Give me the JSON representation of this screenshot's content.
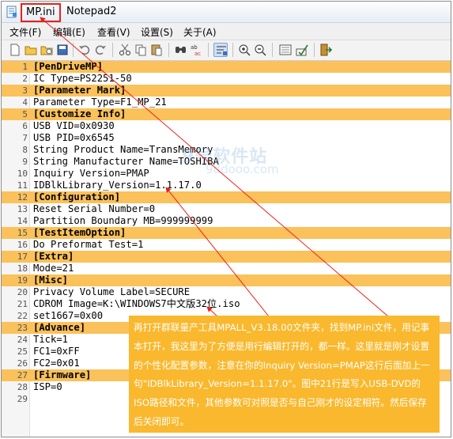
{
  "window": {
    "file_name": "MP.ini",
    "app_name": "Notepad2"
  },
  "menu": [
    {
      "label": "文件(F)"
    },
    {
      "label": "编辑(E)"
    },
    {
      "label": "查看(V)"
    },
    {
      "label": "设置(S)"
    },
    {
      "label": "关于(A)"
    }
  ],
  "toolbar": [
    {
      "icon": "new-file-icon"
    },
    {
      "icon": "open-folder-icon"
    },
    {
      "icon": "browse-icon"
    },
    {
      "icon": "save-icon"
    },
    {
      "icon": "undo-icon"
    },
    {
      "icon": "redo-icon"
    },
    {
      "icon": "cut-icon"
    },
    {
      "icon": "copy-icon"
    },
    {
      "icon": "paste-icon"
    },
    {
      "icon": "find-icon"
    },
    {
      "icon": "replace-icon"
    },
    {
      "icon": "word-wrap-icon"
    },
    {
      "icon": "zoom-in-icon"
    },
    {
      "icon": "zoom-out-icon"
    },
    {
      "icon": "scheme-icon"
    },
    {
      "icon": "customize-icon"
    },
    {
      "icon": "exit-icon"
    }
  ],
  "editor_lines": [
    {
      "n": "1",
      "text": "[PenDriveMP]",
      "section": true
    },
    {
      "n": "2",
      "text": "IC Type=PS2251-50",
      "section": false
    },
    {
      "n": "3",
      "text": "[Parameter Mark]",
      "section": true
    },
    {
      "n": "4",
      "text": "Parameter Type=F1_MP_21",
      "section": false
    },
    {
      "n": "5",
      "text": "[Customize Info]",
      "section": true
    },
    {
      "n": "6",
      "text": "USB VID=0x0930",
      "section": false
    },
    {
      "n": "7",
      "text": "USB PID=0x6545",
      "section": false
    },
    {
      "n": "8",
      "text": "String Product Name=TransMemory",
      "section": false
    },
    {
      "n": "9",
      "text": "String Manufacturer Name=TOSHIBA",
      "section": false
    },
    {
      "n": "10",
      "text": "Inquiry Version=PMAP",
      "section": false
    },
    {
      "n": "11",
      "text": "IDBlkLibrary_Version=1.1.17.0",
      "section": false
    },
    {
      "n": "12",
      "text": "[Configuration]",
      "section": true
    },
    {
      "n": "13",
      "text": "Reset Serial Number=0",
      "section": false
    },
    {
      "n": "14",
      "text": "Partition Boundary MB=999999999",
      "section": false
    },
    {
      "n": "15",
      "text": "[TestItemOption]",
      "section": true
    },
    {
      "n": "16",
      "text": "Do Preformat Test=1",
      "section": false
    },
    {
      "n": "17",
      "text": "[Extra]",
      "section": true
    },
    {
      "n": "18",
      "text": "Mode=21",
      "section": false
    },
    {
      "n": "19",
      "text": "[Misc]",
      "section": true
    },
    {
      "n": "20",
      "text": "Privacy Volume Label=SECURE",
      "section": false
    },
    {
      "n": "21",
      "text": "CDROM Image=K:\\WINDOWS7中文版32位.iso",
      "section": false
    },
    {
      "n": "22",
      "text": "set1667=0x00",
      "section": false
    },
    {
      "n": "23",
      "text": "[Advance]",
      "section": true
    },
    {
      "n": "24",
      "text": "Tick=1",
      "section": false
    },
    {
      "n": "25",
      "text": "FC1=0xFF",
      "section": false
    },
    {
      "n": "26",
      "text": "FC2=0x01",
      "section": false
    },
    {
      "n": "27",
      "text": "[Firmware]",
      "section": true
    },
    {
      "n": "28",
      "text": "ISP=0",
      "section": false
    },
    {
      "n": "29",
      "text": "",
      "section": false
    }
  ],
  "watermark": {
    "main": "9号软件站",
    "sub": "9ddooo.com"
  },
  "annotation": {
    "text": "再打开群联量产工具MPALL_V3.18.00文件夹，找到MP.ini文件，用记事本打开，我这里为了方便是用行编辑打开的，都一样。这里就是刚才设置的个性化配置参数，注意在你的Inquiry Version=PMAP这行后面加上一句\"IDBlkLibrary_Version=1.1.17.0\"。图中21行是写入USB-DVD的ISO路径和文件，其他参数可对照是否与自己刚才的设定相符。然后保存后关闭即可。"
  },
  "colors": {
    "section_highlight": "#fbc15b",
    "annotation_bg": "#f9b82d",
    "annotation_text": "#ffffff",
    "highlight_box": "#e8211b"
  }
}
